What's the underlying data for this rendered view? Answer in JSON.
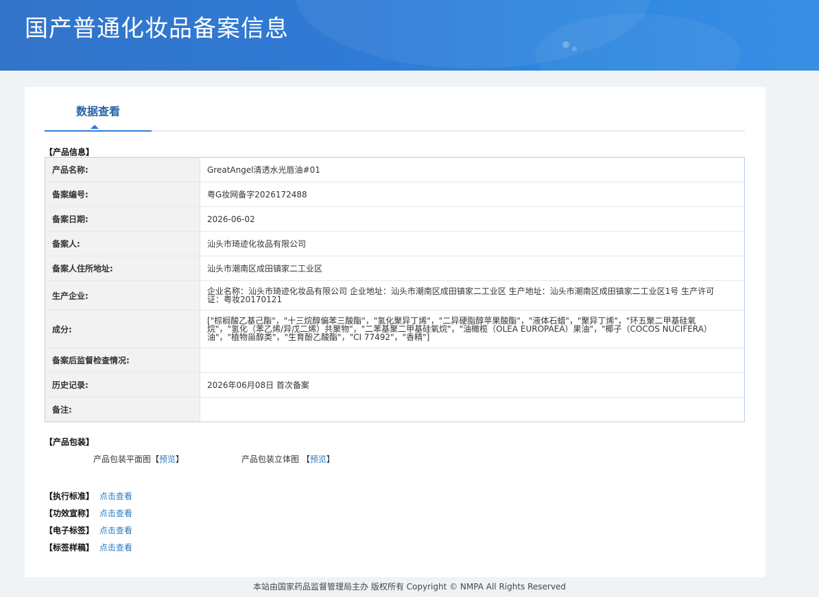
{
  "header": {
    "title": "国产普通化妆品备案信息"
  },
  "tabs": [
    {
      "label": "数据查看"
    }
  ],
  "product_info": {
    "section_title": "【产品信息】",
    "rows": [
      {
        "label": "产品名称:",
        "value": "GreatAngel清透水光唇油#01"
      },
      {
        "label": "备案编号:",
        "value": "粤G妆网备字2026172488"
      },
      {
        "label": "备案日期:",
        "value": "2026-06-02"
      },
      {
        "label": "备案人:",
        "value": "汕头市琦迹化妆品有限公司"
      },
      {
        "label": "备案人住所地址:",
        "value": "汕头市潮南区成田镇家二工业区"
      },
      {
        "label": "生产企业:",
        "value": "企业名称：汕头市琦迹化妆品有限公司 企业地址：汕头市潮南区成田镇家二工业区 生产地址：汕头市潮南区成田镇家二工业区1号 生产许可证：粤妆20170121"
      },
      {
        "label": "成分:",
        "value": "[\"棕榈酸乙基己酯\"，\"十三烷醇偏苯三酸酯\"，\"氢化聚异丁烯\"，\"二异硬脂醇苹果酸酯\"，\"液体石蜡\"，\"聚异丁烯\"，\"环五聚二甲基硅氧烷\"，\"氢化（苯乙烯/异戊二烯）共聚物\"，\"二苯基聚二甲基硅氧烷\"，\"油橄榄（OLEA EUROPAEA）果油\"，\"椰子（COCOS NUCIFERA）油\"，\"植物甾醇类\"，\"生育酚乙酸酯\"，\"CI 77492\"，\"香精\"]"
      },
      {
        "label": "备案后监督检查情况:",
        "value": ""
      },
      {
        "label": "历史记录:",
        "value": "2026年06月08日 首次备案"
      },
      {
        "label": "备注:",
        "value": ""
      }
    ]
  },
  "packaging": {
    "section_title": "【产品包装】",
    "flat_label": "产品包装平面图",
    "flat_link": "预览",
    "stereo_label": "产品包装立体图",
    "stereo_link": "预览",
    "bracket_open": "【",
    "bracket_close": "】"
  },
  "links": [
    {
      "label": "【执行标准】",
      "link": "点击查看"
    },
    {
      "label": "【功效宣称】",
      "link": "点击查看"
    },
    {
      "label": "【电子标签】",
      "link": "点击查看"
    },
    {
      "label": "【标签样稿】",
      "link": "点击查看"
    }
  ],
  "footer": {
    "text": "本站由国家药品监督管理局主办 版权所有 Copyright © NMPA All Rights Reserved"
  },
  "colors": {
    "header_blue": "#2f7bd6",
    "tab_text": "#2561a8",
    "link": "#2a7bc0"
  }
}
